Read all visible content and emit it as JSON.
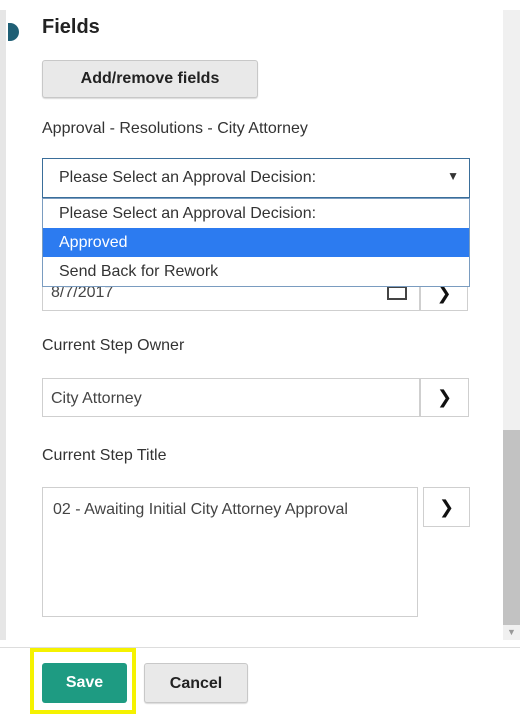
{
  "section": {
    "heading": "Fields",
    "add_remove_label": "Add/remove fields"
  },
  "approval": {
    "label": "Approval - Resolutions - City Attorney",
    "selected": "Please Select an Approval Decision:",
    "options": [
      "Please Select an Approval Decision:",
      "Approved",
      "Send Back for Rework"
    ],
    "highlighted_option": "Approved"
  },
  "date_field": {
    "value": "8/7/2017"
  },
  "step_owner": {
    "label": "Current Step Owner",
    "value": "City Attorney"
  },
  "step_title": {
    "label": "Current Step Title",
    "value": "02 - Awaiting Initial City Attorney Approval"
  },
  "footer": {
    "save_label": "Save",
    "cancel_label": "Cancel"
  },
  "colors": {
    "save_bg": "#1e9b82",
    "highlight_outline": "#f5f200",
    "option_selected": "#2c7bf0"
  },
  "icons": {
    "arrow": "❯",
    "caret": "▼",
    "calendar": "calendar-icon"
  }
}
